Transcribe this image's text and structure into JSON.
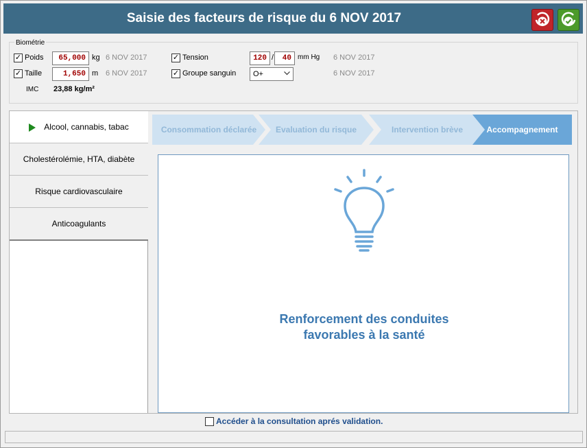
{
  "window": {
    "title": "Saisie des facteurs de risque du 6 NOV 2017"
  },
  "biometrie": {
    "legend": "Biométrie",
    "poids": {
      "checked": true,
      "label": "Poids",
      "value": "65,000",
      "unit": "kg",
      "date": "6 NOV 2017"
    },
    "taille": {
      "checked": true,
      "label": "Taille",
      "value": "1,650",
      "unit": "m",
      "date": "6 NOV 2017"
    },
    "imc": {
      "label": "IMC",
      "value": "23,88 kg/m²"
    },
    "tension": {
      "checked": true,
      "label": "Tension",
      "systolic": "120",
      "separator": "/",
      "diastolic": "40",
      "unit": "mm Hg",
      "date": "6 NOV 2017"
    },
    "groupe": {
      "checked": true,
      "label": "Groupe sanguin",
      "value": "O+",
      "date": "6 NOV 2017"
    }
  },
  "nav": {
    "items": [
      {
        "label": "Alcool, cannabis, tabac",
        "active": true
      },
      {
        "label": "Cholestérolémie, HTA, diabète",
        "active": false
      },
      {
        "label": "Risque cardiovasculaire",
        "active": false
      },
      {
        "label": "Anticoagulants",
        "active": false
      }
    ]
  },
  "steps": [
    {
      "label": "Consommation déclarée",
      "current": false
    },
    {
      "label": "Evaluation du risque",
      "current": false
    },
    {
      "label": "Intervention brève",
      "current": false
    },
    {
      "label": "Accompagnement",
      "current": true
    }
  ],
  "panel": {
    "icon": "lightbulb-icon",
    "message_line1": "Renforcement des conduites",
    "message_line2": "favorables à la santé"
  },
  "footer": {
    "checked": false,
    "label": "Accéder à la consultation aprés validation."
  },
  "colors": {
    "titlebar": "#3d6b87",
    "accent_blue": "#3b78b0",
    "step_inactive": "#cfe2f2",
    "step_active": "#6aa6d8",
    "cancel_red": "#c0242a",
    "ok_green": "#4c9a2a"
  }
}
